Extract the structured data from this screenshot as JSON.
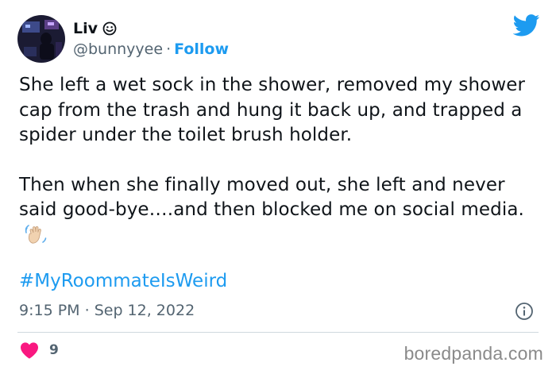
{
  "author": {
    "display_name": "Liv",
    "name_emoji": "smiling-face-icon",
    "handle": "@bunnyyee",
    "separator": "·",
    "follow_label": "Follow"
  },
  "tweet": {
    "paragraph_1": "She left a wet sock in the shower, removed my shower cap from the trash and hung it back up, and trapped a spider under the toilet brush holder.",
    "paragraph_2": "Then when she finally moved out, she left and never said good-bye….and then blocked me on social media.",
    "paragraph_2_emoji": "waving-hand-icon",
    "hashtag": "#MyRoommateIsWeird",
    "time": "9:15 PM",
    "separator": "·",
    "date": "Sep 12, 2022"
  },
  "engagement": {
    "like_count": "9"
  },
  "watermark": "boredpanda.com",
  "colors": {
    "accent": "#1d9bf0",
    "heart": "#f91880",
    "muted_text": "#536471",
    "body_text": "#0f1419",
    "divider": "#cfd9de"
  },
  "icons": {
    "platform": "twitter-bird-icon",
    "info": "info-icon",
    "like": "heart-icon"
  }
}
